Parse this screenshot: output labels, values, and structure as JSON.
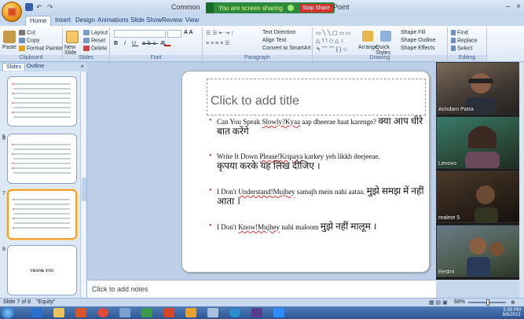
{
  "window": {
    "title_left": "Common",
    "title_right": "Point",
    "sharing_message": "You are screen sharing",
    "stop_share_label": "Stop Share",
    "minimize_label": "–",
    "close_label": "×"
  },
  "tabs": [
    "Home",
    "Insert",
    "Design",
    "Animations",
    "Slide Show",
    "Review",
    "View"
  ],
  "ribbon": {
    "clipboard": {
      "cut": "Cut",
      "copy": "Copy",
      "paste": "Paste",
      "format_painter": "Format Painter",
      "label": "Clipboard"
    },
    "slides": {
      "new_slide": "New Slide",
      "layout": "Layout",
      "reset": "Reset",
      "delete": "Delete",
      "label": "Slides"
    },
    "font": {
      "label": "Font",
      "font_name": "",
      "font_size": ""
    },
    "paragraph": {
      "text_direction": "Text Direction",
      "align_text": "Align Text",
      "smartart": "Convert to SmartArt",
      "label": "Paragraph"
    },
    "drawing": {
      "arrange": "Arrange",
      "quick_styles": "Quick Styles",
      "shape_fill": "Shape Fill",
      "shape_outline": "Shape Outline",
      "shape_effects": "Shape Effects",
      "label": "Drawing"
    },
    "editing": {
      "find": "Find",
      "replace": "Replace",
      "select": "Select",
      "label": "Editing"
    }
  },
  "panel": {
    "tab_slides": "Slides",
    "tab_outline": "Outline",
    "close": "×",
    "thumbnails": [
      {
        "num": "5"
      },
      {
        "num": "6"
      },
      {
        "num": "7"
      },
      {
        "num": "8",
        "text": "THANK YOU"
      }
    ]
  },
  "slide": {
    "title_placeholder": "Click to add title",
    "bullets": [
      {
        "en": "Can You Speak ",
        "ul": "Slowly?Kyaa",
        "en2": " aap dheeraе baat karenge?",
        "hi": "क्या आप धीरे बात करेंगे"
      },
      {
        "en": "Write It Down ",
        "ul": "Please!Kripaya",
        "en2": " karkey yeh likkh deejeeae.",
        "hi": "कृपया करके यह लिख दीजिए ।"
      },
      {
        "en": "I Don't ",
        "ul": "Understand!Mujhey",
        "en2": " samajh mein nahi aataa.",
        "hi": "मुझे समझ में नहीं आता ।"
      },
      {
        "en": "I Don't ",
        "ul": "Know!Mujhey",
        "en2": " nahi maloom",
        "hi": "मुझे नहीं मालूम ।"
      }
    ]
  },
  "notes": {
    "placeholder": "Click to add notes"
  },
  "participants": [
    {
      "name": "Arindam Patra"
    },
    {
      "name": "Lenovo"
    },
    {
      "name": "realme 5"
    },
    {
      "name": "Redmi"
    }
  ],
  "status": {
    "slide_info": "Slide 7 of 8",
    "theme": "\"Equity\"",
    "zoom": "68%"
  },
  "taskbar": {
    "time": "5:59 PM",
    "date": "8/6/2021"
  },
  "colors": {
    "share_green": "#2b8a3e",
    "stop_red": "#d63030",
    "bullet_red": "#c0392b",
    "selected_thumb": "#f0a030"
  }
}
